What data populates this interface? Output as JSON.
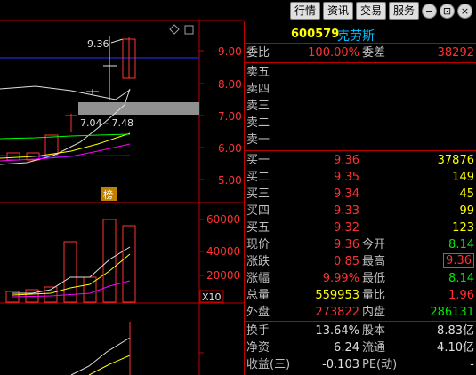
{
  "toolbar": {
    "tabs": [
      "行情",
      "资讯",
      "交易",
      "服务"
    ]
  },
  "stock": {
    "code": "600579",
    "name": "克劳斯"
  },
  "weibi": {
    "label1": "委比",
    "value1": "100.00%",
    "label2": "委差",
    "value2": "38292"
  },
  "sell_orders": [
    {
      "label": "卖五",
      "price": "",
      "vol": ""
    },
    {
      "label": "卖四",
      "price": "",
      "vol": ""
    },
    {
      "label": "卖三",
      "price": "",
      "vol": ""
    },
    {
      "label": "卖二",
      "price": "",
      "vol": ""
    },
    {
      "label": "卖一",
      "price": "",
      "vol": ""
    }
  ],
  "buy_orders": [
    {
      "label": "买一",
      "price": "9.36",
      "vol": "37876"
    },
    {
      "label": "买二",
      "price": "9.35",
      "vol": "149"
    },
    {
      "label": "买三",
      "price": "9.34",
      "vol": "45"
    },
    {
      "label": "买四",
      "price": "9.33",
      "vol": "99"
    },
    {
      "label": "买五",
      "price": "9.32",
      "vol": "123"
    }
  ],
  "quote": [
    {
      "l1": "现价",
      "v1": "9.36",
      "c1": "red",
      "l2": "今开",
      "v2": "8.14",
      "c2": "green",
      "box2": false
    },
    {
      "l1": "涨跌",
      "v1": "0.85",
      "c1": "red",
      "l2": "最高",
      "v2": "9.36",
      "c2": "red",
      "box2": true
    },
    {
      "l1": "涨幅",
      "v1": "9.99%",
      "c1": "red",
      "l2": "最低",
      "v2": "8.14",
      "c2": "green",
      "box2": false
    },
    {
      "l1": "总量",
      "v1": "559953",
      "c1": "yellow",
      "l2": "量比",
      "v2": "1.96",
      "c2": "red",
      "box2": false
    },
    {
      "l1": "外盘",
      "v1": "273822",
      "c1": "red",
      "l2": "内盘",
      "v2": "286131",
      "c2": "green",
      "box2": false
    }
  ],
  "finance": [
    {
      "l1": "换手",
      "v1": "13.64%",
      "l2": "股本",
      "v2": "8.83亿"
    },
    {
      "l1": "净资",
      "v1": "6.24",
      "l2": "流通",
      "v2": "4.10亿"
    },
    {
      "l1": "收益(三)",
      "v1": "-0.103",
      "l2": "PE(动)",
      "v2": "-"
    }
  ],
  "chart": {
    "price_axis": [
      "9.00",
      "8.00",
      "7.00",
      "6.00",
      "5.00"
    ],
    "volume_axis": [
      "60000",
      "40000",
      "20000"
    ],
    "volume_unit": "X10",
    "high_label": "9.36",
    "range_label": "7.04 - 7.48",
    "badge": "榜",
    "colors": {
      "up": "#ff3232",
      "ma5": "#ffffff",
      "ma10": "#ffff00",
      "ma20": "#ff00ff",
      "ma60": "#00ff00",
      "grid": "#c00000",
      "bluelevel": "#3030ff"
    }
  }
}
